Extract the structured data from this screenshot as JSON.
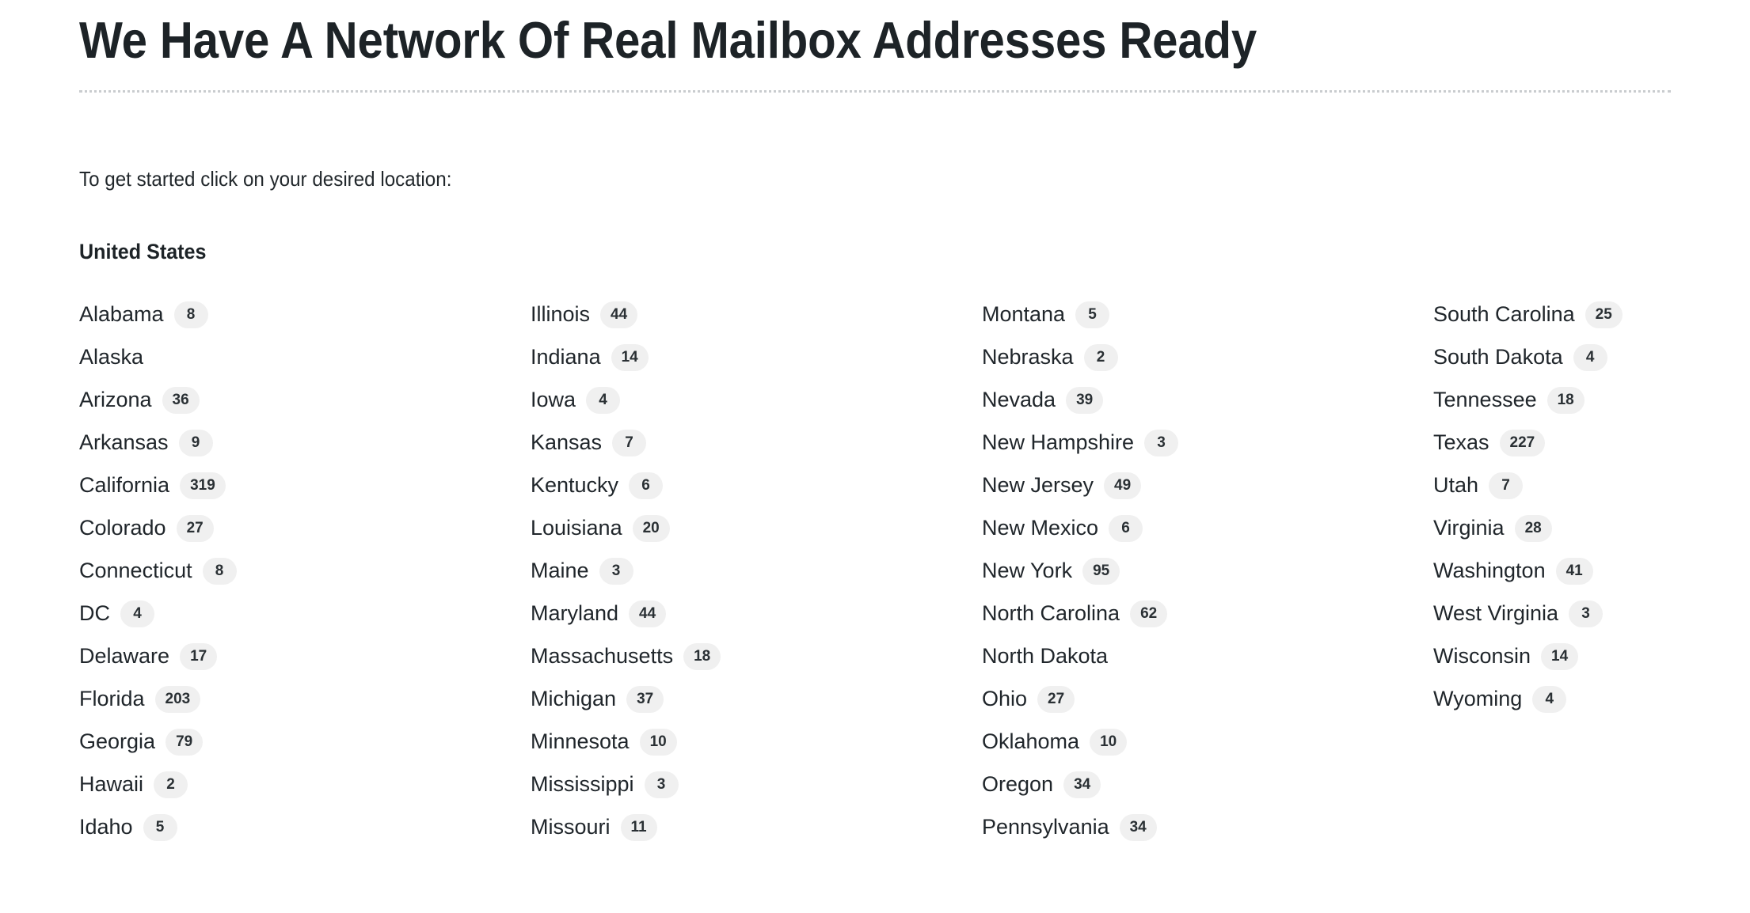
{
  "header": {
    "title": "We Have A Network Of Real Mailbox Addresses Ready"
  },
  "intro": {
    "text": "To get started click on your desired location:"
  },
  "country": {
    "heading": "United States"
  },
  "colors": {
    "title_text": "#1d2327",
    "body_text": "#20262b",
    "badge_background": "#f0f0f0",
    "badge_text": "#2a3034",
    "divider": "#c9cccf",
    "page_background": "#ffffff"
  },
  "columns": [
    {
      "items": [
        {
          "name": "Alabama",
          "count": "8"
        },
        {
          "name": "Alaska",
          "count": ""
        },
        {
          "name": "Arizona",
          "count": "36"
        },
        {
          "name": "Arkansas",
          "count": "9"
        },
        {
          "name": "California",
          "count": "319"
        },
        {
          "name": "Colorado",
          "count": "27"
        },
        {
          "name": "Connecticut",
          "count": "8"
        },
        {
          "name": "DC",
          "count": "4"
        },
        {
          "name": "Delaware",
          "count": "17"
        },
        {
          "name": "Florida",
          "count": "203"
        },
        {
          "name": "Georgia",
          "count": "79"
        },
        {
          "name": "Hawaii",
          "count": "2"
        },
        {
          "name": "Idaho",
          "count": "5"
        }
      ]
    },
    {
      "items": [
        {
          "name": "Illinois",
          "count": "44"
        },
        {
          "name": "Indiana",
          "count": "14"
        },
        {
          "name": "Iowa",
          "count": "4"
        },
        {
          "name": "Kansas",
          "count": "7"
        },
        {
          "name": "Kentucky",
          "count": "6"
        },
        {
          "name": "Louisiana",
          "count": "20"
        },
        {
          "name": "Maine",
          "count": "3"
        },
        {
          "name": "Maryland",
          "count": "44"
        },
        {
          "name": "Massachusetts",
          "count": "18"
        },
        {
          "name": "Michigan",
          "count": "37"
        },
        {
          "name": "Minnesota",
          "count": "10"
        },
        {
          "name": "Mississippi",
          "count": "3"
        },
        {
          "name": "Missouri",
          "count": "11"
        }
      ]
    },
    {
      "items": [
        {
          "name": "Montana",
          "count": "5"
        },
        {
          "name": "Nebraska",
          "count": "2"
        },
        {
          "name": "Nevada",
          "count": "39"
        },
        {
          "name": "New Hampshire",
          "count": "3"
        },
        {
          "name": "New Jersey",
          "count": "49"
        },
        {
          "name": "New Mexico",
          "count": "6"
        },
        {
          "name": "New York",
          "count": "95"
        },
        {
          "name": "North Carolina",
          "count": "62"
        },
        {
          "name": "North Dakota",
          "count": ""
        },
        {
          "name": "Ohio",
          "count": "27"
        },
        {
          "name": "Oklahoma",
          "count": "10"
        },
        {
          "name": "Oregon",
          "count": "34"
        },
        {
          "name": "Pennsylvania",
          "count": "34"
        }
      ]
    },
    {
      "items": [
        {
          "name": "South Carolina",
          "count": "25"
        },
        {
          "name": "South Dakota",
          "count": "4"
        },
        {
          "name": "Tennessee",
          "count": "18"
        },
        {
          "name": "Texas",
          "count": "227"
        },
        {
          "name": "Utah",
          "count": "7"
        },
        {
          "name": "Virginia",
          "count": "28"
        },
        {
          "name": "Washington",
          "count": "41"
        },
        {
          "name": "West Virginia",
          "count": "3"
        },
        {
          "name": "Wisconsin",
          "count": "14"
        },
        {
          "name": "Wyoming",
          "count": "4"
        }
      ]
    }
  ]
}
